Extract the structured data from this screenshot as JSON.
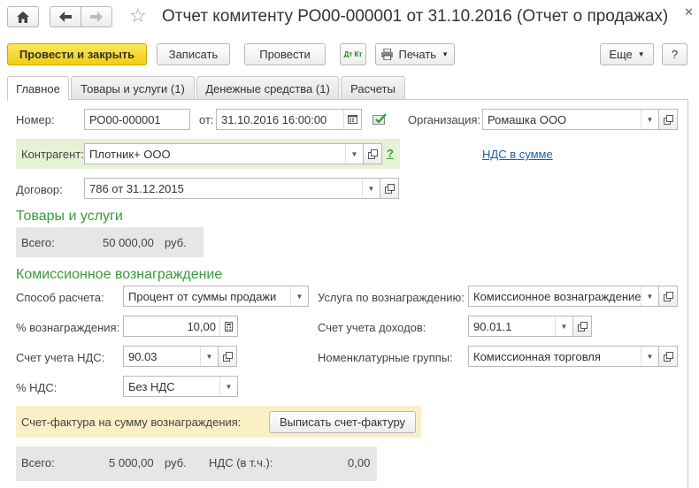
{
  "window": {
    "title": "Отчет комитенту РО00-000001 от 31.10.2016 (Отчет о продажах)"
  },
  "toolbar": {
    "post_close_label": "Провести и закрыть",
    "save_label": "Записать",
    "post_label": "Провести",
    "dtkt_label": "Дт Кт",
    "print_label": "Печать",
    "more_label": "Еще",
    "help_label": "?"
  },
  "tabs": [
    {
      "label": "Главное",
      "active": true
    },
    {
      "label": "Товары и услуги (1)",
      "active": false
    },
    {
      "label": "Денежные средства (1)",
      "active": false
    },
    {
      "label": "Расчеты",
      "active": false
    }
  ],
  "form": {
    "number_label": "Номер:",
    "number_value": "РО00-000001",
    "date_label": "от:",
    "date_value": "31.10.2016 16:00:00",
    "org_label": "Организация:",
    "org_value": "Ромашка ООО",
    "counterparty_label": "Контрагент:",
    "counterparty_value": "Плотник+ ООО",
    "vat_link": "НДС в сумме",
    "contract_label": "Договор:",
    "contract_value": "786 от 31.12.2015"
  },
  "goods": {
    "section_title": "Товары и услуги",
    "total_label": "Всего:",
    "total_value": "50 000,00",
    "currency": "руб."
  },
  "commission": {
    "section_title": "Комиссионное вознаграждение",
    "calc_method_label": "Способ расчета:",
    "calc_method_value": "Процент от суммы продажи",
    "service_label": "Услуга по вознаграждению:",
    "service_value": "Комиссионное вознаграждение",
    "percent_label": "% вознаграждения:",
    "percent_value": "10,00",
    "income_account_label": "Счет учета доходов:",
    "income_account_value": "90.01.1",
    "vat_account_label": "Счет учета НДС:",
    "vat_account_value": "90.03",
    "nomenclature_label": "Номенклатурные группы:",
    "nomenclature_value": "Комиссионная торговля",
    "vat_rate_label": "% НДС:",
    "vat_rate_value": "Без НДС",
    "invoice_label": "Счет-фактура на сумму вознаграждения:",
    "invoice_button": "Выписать счет-фактуру",
    "total_label": "Всего:",
    "total_value": "5 000,00",
    "currency": "руб.",
    "vat_incl_label": "НДС (в т.ч.):",
    "vat_incl_value": "0,00"
  },
  "colors": {
    "primary_button": "#f1cc12",
    "section_title": "#3a9b3a",
    "link": "#1a5fa8",
    "highlight_green": "#e6f2d6",
    "highlight_yellow": "#fbefc6",
    "totals_grey": "#e6e6e6"
  }
}
